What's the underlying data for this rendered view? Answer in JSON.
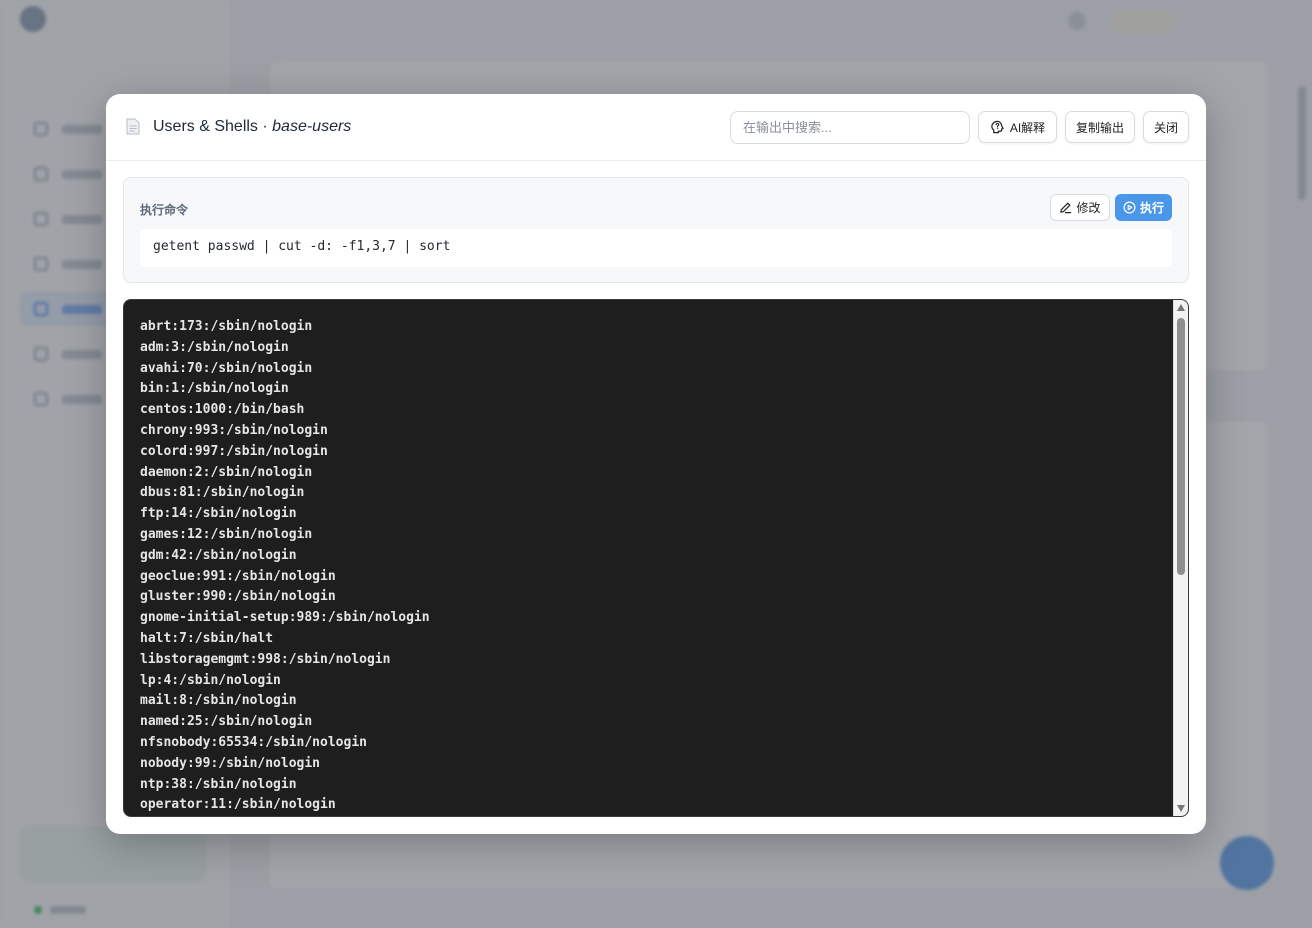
{
  "modal": {
    "title": "Users & Shells · ",
    "title_sub": "base-users",
    "search_placeholder": "在输出中搜索...",
    "ai_button": "AI解释",
    "copy_button": "复制输出",
    "close_button": "关闭"
  },
  "command": {
    "label": "执行命令",
    "edit_button": "修改",
    "run_button": "执行",
    "text": "getent passwd | cut -d: -f1,3,7 | sort"
  },
  "output": {
    "lines": [
      "abrt:173:/sbin/nologin",
      "adm:3:/sbin/nologin",
      "avahi:70:/sbin/nologin",
      "bin:1:/sbin/nologin",
      "centos:1000:/bin/bash",
      "chrony:993:/sbin/nologin",
      "colord:997:/sbin/nologin",
      "daemon:2:/sbin/nologin",
      "dbus:81:/sbin/nologin",
      "ftp:14:/sbin/nologin",
      "games:12:/sbin/nologin",
      "gdm:42:/sbin/nologin",
      "geoclue:991:/sbin/nologin",
      "gluster:990:/sbin/nologin",
      "gnome-initial-setup:989:/sbin/nologin",
      "halt:7:/sbin/halt",
      "libstoragemgmt:998:/sbin/nologin",
      "lp:4:/sbin/nologin",
      "mail:8:/sbin/nologin",
      "named:25:/sbin/nologin",
      "nfsnobody:65534:/sbin/nologin",
      "nobody:99:/sbin/nologin",
      "ntp:38:/sbin/nologin",
      "operator:11:/sbin/nologin"
    ]
  },
  "colors": {
    "accent": "#4a96e8",
    "terminal_bg": "#1e1e1e",
    "terminal_text": "#e6e6e6"
  },
  "icons": {
    "title": "file-icon",
    "ai": "brain-icon",
    "edit": "pencil-icon",
    "run": "play-circle-icon"
  }
}
